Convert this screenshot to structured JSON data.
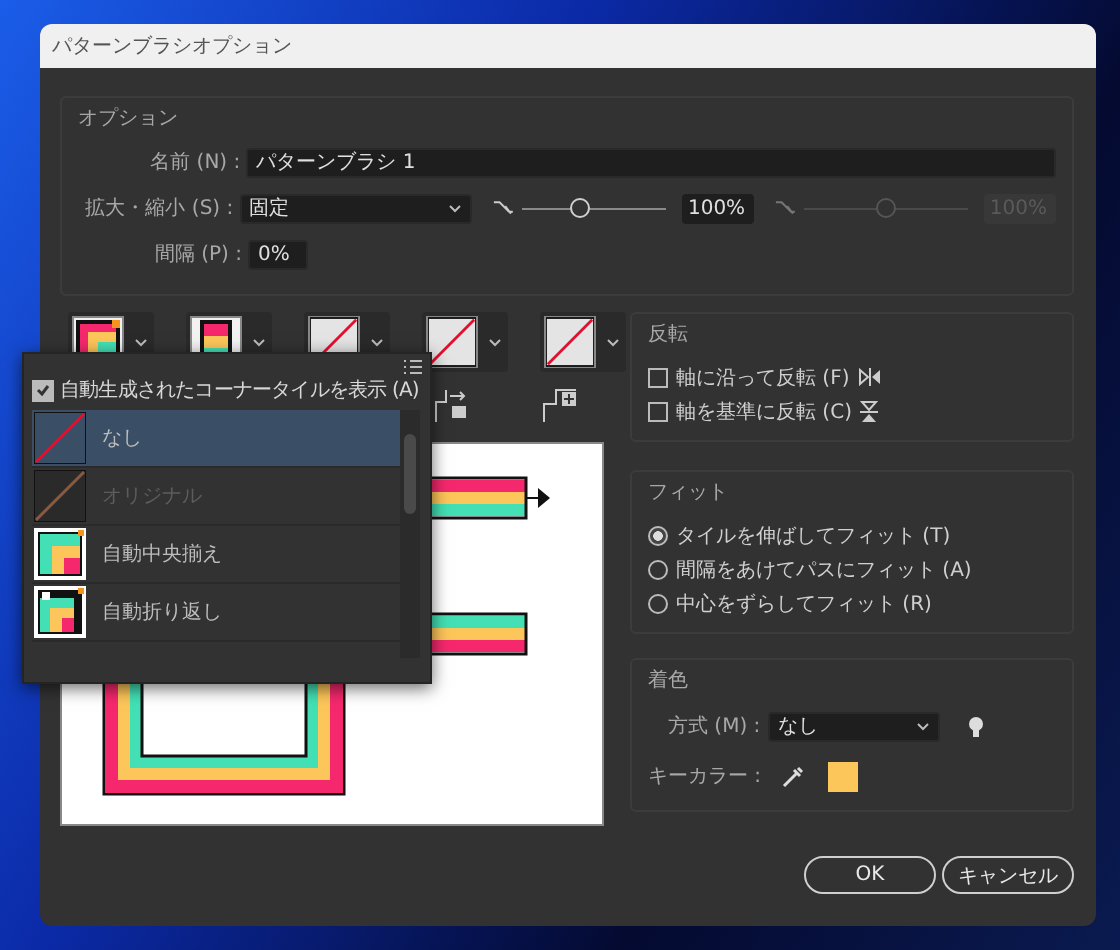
{
  "window": {
    "title": "パターンブラシオプション"
  },
  "options": {
    "legend": "オプション",
    "name_label": "名前 (N) :",
    "name_value": "パターンブラシ 1",
    "scale_label": "拡大・縮小 (S) :",
    "scale_value": "固定",
    "min_slider": {
      "level": 0.4,
      "reading": "100%",
      "disabled": false
    },
    "max_slider": {
      "level": 0.5,
      "reading": "100%",
      "disabled": true
    },
    "spacing_label": "間隔 (P) :",
    "spacing_value": "0%"
  },
  "tiles": [
    {
      "kind": "corner"
    },
    {
      "kind": "side"
    },
    {
      "kind": "none"
    },
    {
      "kind": "none"
    },
    {
      "kind": "none"
    }
  ],
  "corner_popup": {
    "show_auto": {
      "label": "自動生成されたコーナータイルを表示 (A)",
      "checked": true
    },
    "items": [
      {
        "label": "なし",
        "kind": "none",
        "selected": true,
        "disabled": false
      },
      {
        "label": "オリジナル",
        "kind": "original",
        "selected": false,
        "disabled": true
      },
      {
        "label": "自動中央揃え",
        "kind": "auto-center",
        "selected": false,
        "disabled": false
      },
      {
        "label": "自動折り返し",
        "kind": "auto-wrap",
        "selected": false,
        "disabled": false
      }
    ]
  },
  "flip": {
    "legend": "反転",
    "options": [
      {
        "label": "軸に沿って反転 (F)",
        "checked": false,
        "kind": "along"
      },
      {
        "label": "軸を基準に反転 (C)",
        "checked": false,
        "kind": "across"
      }
    ]
  },
  "fit": {
    "legend": "フィット",
    "options": [
      {
        "label": "タイルを伸ばしてフィット (T)",
        "selected": true
      },
      {
        "label": "間隔をあけてパスにフィット (A)",
        "selected": false
      },
      {
        "label": "中心をずらしてフィット (R)",
        "selected": false
      }
    ]
  },
  "colorization": {
    "legend": "着色",
    "method_label": "方式 (M) :",
    "method_value": "なし",
    "key_color_label": "キーカラー :"
  },
  "buttons": [
    "OK",
    "キャンセル"
  ]
}
